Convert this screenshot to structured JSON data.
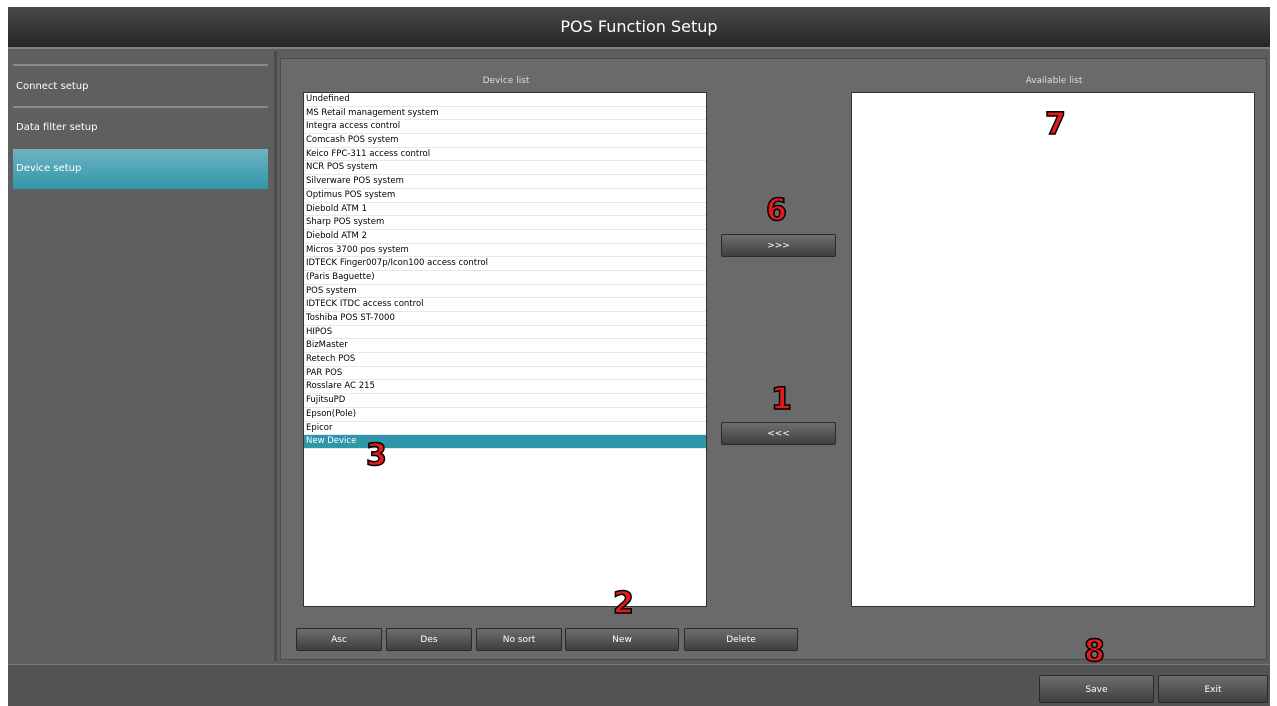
{
  "window": {
    "title": "POS Function Setup"
  },
  "sidebar": {
    "items": [
      {
        "label": "Connect setup"
      },
      {
        "label": "Data filter setup"
      },
      {
        "label": "Device setup"
      }
    ]
  },
  "device_list": {
    "header": "Device list",
    "items": [
      "Undefined",
      "MS Retail management system",
      "Integra access control",
      "Comcash POS system",
      "Keico FPC-311 access control",
      "NCR POS system",
      "Silverware POS system",
      "Optimus POS system",
      "Diebold ATM 1",
      "Sharp POS system",
      "Diebold ATM 2",
      "Micros 3700 pos system",
      "IDTECK Finger007p/Icon100 access control",
      "(Paris Baguette)",
      "POS system",
      "IDTECK ITDC access control",
      "Toshiba POS ST-7000",
      "HIPOS",
      "BizMaster",
      "Retech POS",
      "PAR POS",
      "Rosslare AC 215",
      "FujitsuPD",
      "Epson(Pole)",
      "Epicor",
      "New Device"
    ],
    "selected": "New Device"
  },
  "available_list": {
    "header": "Available list",
    "items": []
  },
  "transfer": {
    "add_label": ">>>",
    "remove_label": "<<<"
  },
  "sort_buttons": {
    "asc": "Asc",
    "des": "Des",
    "no_sort": "No sort",
    "new": "New",
    "delete": "Delete"
  },
  "footer": {
    "save": "Save",
    "exit": "Exit"
  },
  "callouts": [
    "1",
    "2",
    "3",
    "6",
    "7",
    "8"
  ],
  "colors": {
    "accent": "#2f97aa",
    "background": "#5d5d5d",
    "callout": "#e31b1b"
  }
}
